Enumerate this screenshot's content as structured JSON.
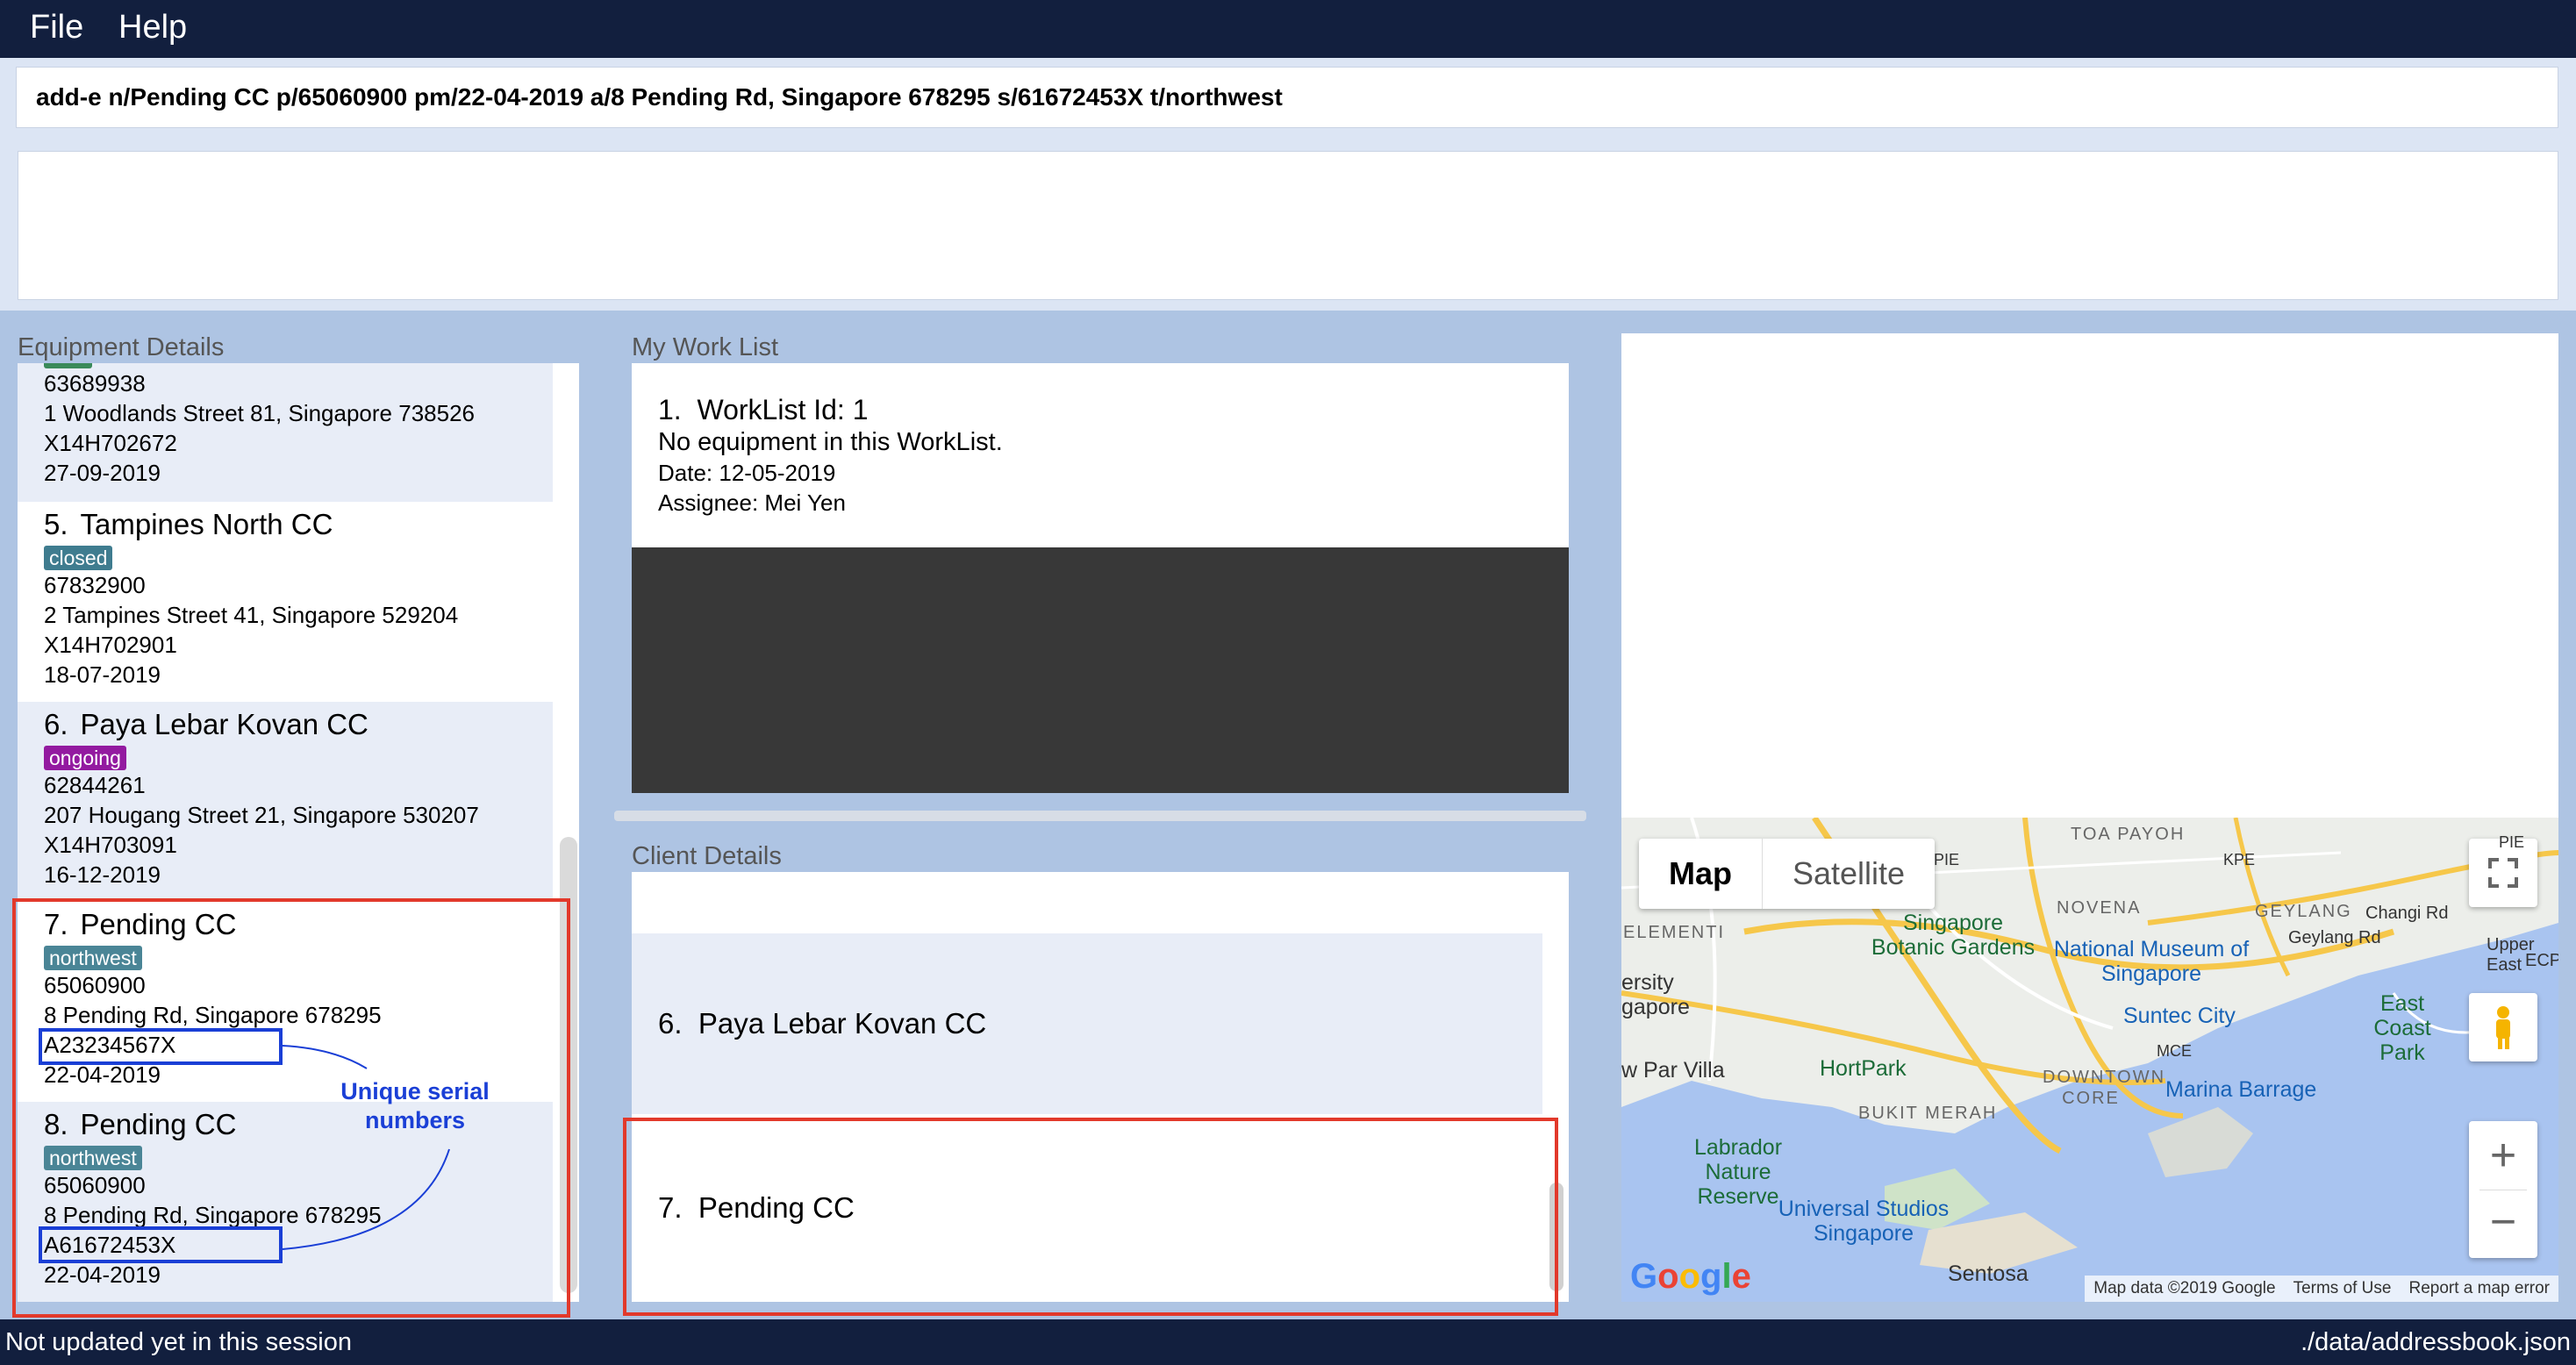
{
  "menu": {
    "file": "File",
    "help": "Help"
  },
  "command": {
    "value": "add-e n/Pending CC p/65060900 pm/22-04-2019 a/8 Pending Rd, Singapore 678295 s/61672453X t/northwest"
  },
  "labels": {
    "equipment": "Equipment Details",
    "worklist": "My Work List",
    "client": "Client Details"
  },
  "equipment": [
    {
      "tag": "east",
      "phone": "63689938",
      "address": "1 Woodlands Street 81, Singapore 738526",
      "serial": "X14H702672",
      "date": "27-09-2019"
    },
    {
      "index": "5.",
      "name": "Tampines North CC",
      "tag": "closed",
      "phone": "67832900",
      "address": "2 Tampines Street 41, Singapore 529204",
      "serial": "X14H702901",
      "date": "18-07-2019"
    },
    {
      "index": "6.",
      "name": "Paya Lebar Kovan CC",
      "tag": "ongoing",
      "phone": "62844261",
      "address": "207 Hougang Street 21, Singapore 530207",
      "serial": "X14H703091",
      "date": "16-12-2019"
    },
    {
      "index": "7.",
      "name": "Pending CC",
      "tag": "northwest",
      "phone": "65060900",
      "address": "8 Pending Rd, Singapore 678295",
      "serial": "A23234567X",
      "date": "22-04-2019"
    },
    {
      "index": "8.",
      "name": "Pending CC",
      "tag": "northwest",
      "phone": "65060900",
      "address": "8 Pending Rd, Singapore 678295",
      "serial": "A61672453X",
      "date": "22-04-2019"
    }
  ],
  "annotation": {
    "line1": "Unique serial",
    "line2": "numbers"
  },
  "worklist": {
    "index": "1.",
    "title": "WorkList Id: 1",
    "empty": "No equipment in this WorkList.",
    "date": "Date: 12-05-2019",
    "assignee": "Assignee: Mei Yen"
  },
  "clients": [
    {
      "index": "6.",
      "name": "Paya Lebar Kovan CC"
    },
    {
      "index": "7.",
      "name": "Pending CC"
    }
  ],
  "map": {
    "map_button": "Map",
    "satellite_button": "Satellite",
    "labels": {
      "toa_payoh": "TOA PAYOH",
      "novena": "NOVENA",
      "geylang": "GEYLANG",
      "botanic": "Singapore Botanic Gardens",
      "museum": "National Museum of Singapore",
      "elementi": "ELEMENTI",
      "ersity": "ersity gapore",
      "suntec": "Suntec City",
      "east_coast": "East Coast Park",
      "pasir": "w Par Villa",
      "hortpark": "HortPark",
      "downtown": "DOWNTOWN CORE",
      "bukit_merah": "BUKIT MERAH",
      "marina": "Marina Barrage",
      "labrador": "Labrador Nature Reserve",
      "universal": "Universal Studios Singapore",
      "sentosa": "Sentosa",
      "geylang_rd": "Geylang Rd",
      "changi_rd": "Changi Rd",
      "upper_east": "Upper East",
      "ecp": "ECP",
      "pie": "PIE",
      "kpe": "KPE",
      "mce": "MCE",
      "pie2": "PIE"
    },
    "google": "Google",
    "attribution": {
      "data": "Map data ©2019 Google",
      "terms": "Terms of Use",
      "report": "Report a map error"
    }
  },
  "status": {
    "left": "Not updated yet in this session",
    "right": "./data/addressbook.json"
  },
  "colors": {
    "northwest": "#4a8596",
    "closed": "#3f7c8f",
    "ongoing": "#931aa0",
    "east": "#3a8a5a",
    "annotation_red": "#e2392b",
    "annotation_blue": "#1a3fd6"
  }
}
